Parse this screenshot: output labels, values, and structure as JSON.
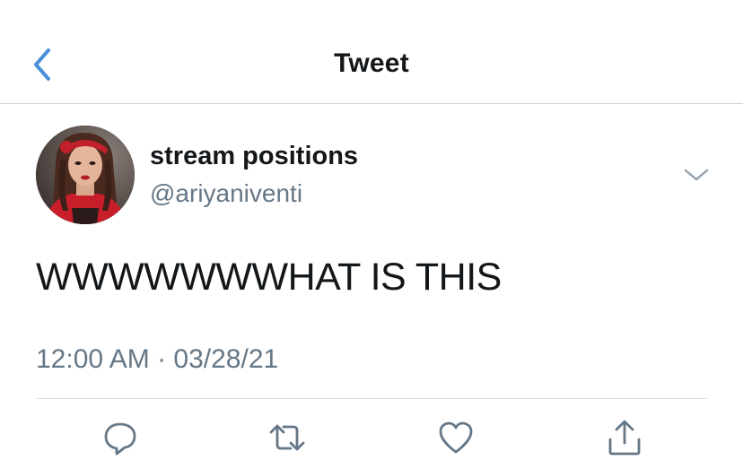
{
  "header": {
    "title": "Tweet",
    "back_icon": "chevron-left-icon",
    "accent_color": "#4a90d9"
  },
  "tweet": {
    "author": {
      "display_name": "stream positions",
      "handle": "@ariyaniventi"
    },
    "text": "WWWWWWWHAT IS THIS",
    "timestamp": "12:00 AM · 03/28/21"
  },
  "actions": [
    {
      "name": "reply",
      "icon": "reply-icon"
    },
    {
      "name": "retweet",
      "icon": "retweet-icon"
    },
    {
      "name": "like",
      "icon": "heart-icon"
    },
    {
      "name": "share",
      "icon": "share-icon"
    }
  ],
  "colors": {
    "primary_text": "#14171a",
    "secondary_text": "#657786",
    "icon_gray": "#657786",
    "divider": "#d8dde2"
  }
}
